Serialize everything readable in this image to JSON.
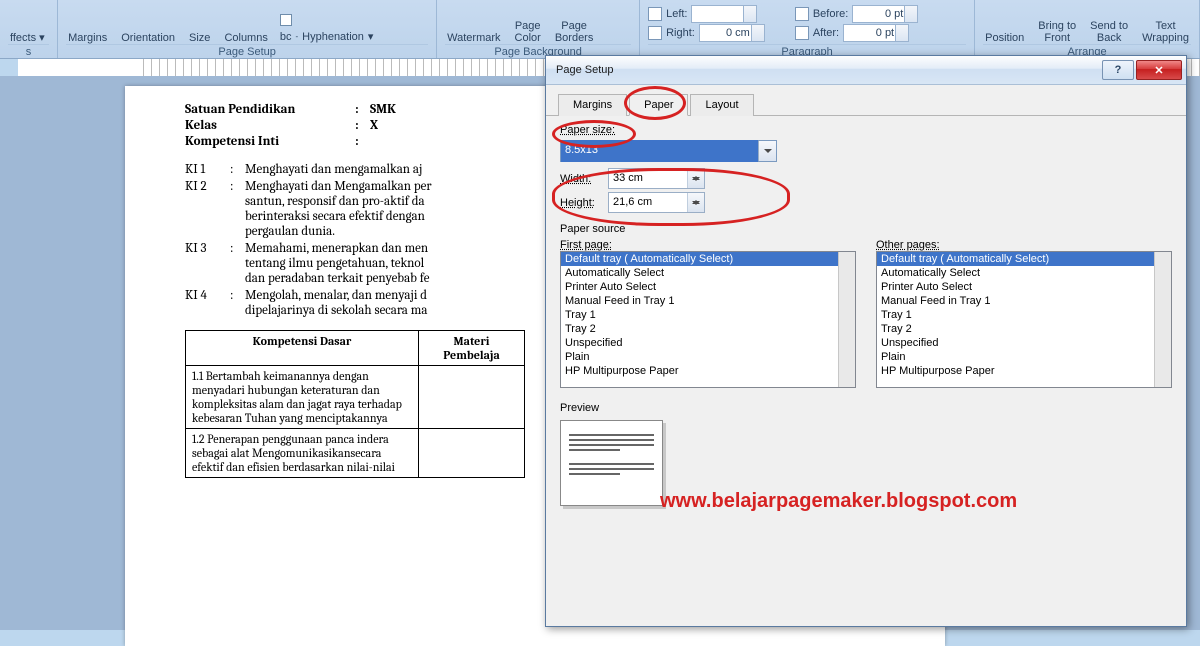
{
  "ribbon": {
    "pageSetup": {
      "label": "Page Setup",
      "margins": "Margins",
      "orientation": "Orientation",
      "size": "Size",
      "columns": "Columns",
      "hyphenation": "Hyphenation"
    },
    "pageBackground": {
      "label": "Page Background",
      "watermark": "Watermark",
      "pageColor": "Page\nColor",
      "pageBorders": "Page\nBorders"
    },
    "paragraph": {
      "label": "Paragraph",
      "left": "Left:",
      "right": "Right:",
      "before": "Before:",
      "after": "After:",
      "val_right": "0 cm",
      "val_before": "0 pt",
      "val_after": "0 pt"
    },
    "arrange": {
      "label": "Arrange",
      "position": "Position",
      "bringFront": "Bring to\nFront",
      "sendBack": "Send to\nBack",
      "textWrap": "Text\nWrapping"
    }
  },
  "document": {
    "rows": [
      {
        "label": "Satuan Pendidikan",
        "value": "SMK"
      },
      {
        "label": "Kelas",
        "value": "X"
      },
      {
        "label": "Kompetensi Inti",
        "value": ""
      }
    ],
    "ki": [
      {
        "n": "KI 1",
        "t": "Menghayati dan mengamalkan  aj"
      },
      {
        "n": "KI 2",
        "t": "Menghayati dan Mengamalkan per\nsantun, responsif dan pro-aktif da\nberinteraksi secara efektif dengan\npergaulan dunia."
      },
      {
        "n": "KI 3",
        "t": "Memahami, menerapkan dan men\ntentang ilmu pengetahuan, teknol\ndan peradaban terkait penyebab fe"
      },
      {
        "n": "KI 4",
        "t": "Mengolah, menalar, dan menyaji d\ndipelajarinya di sekolah secara ma"
      }
    ],
    "table": {
      "h1": "Kompetensi Dasar",
      "h2": "Materi\nPembelaja",
      "r1": "1.1  Bertambah keimanannya dengan menyadari hubungan keteraturan dan kompleksitas alam dan jagat raya terhadap kebesaran Tuhan yang menciptakannya",
      "r2": "1.2  Penerapan penggunaan panca indera sebagai alat Mengomunikasikansecara efektif dan efisien berdasarkan nilai-nilai"
    }
  },
  "dialog": {
    "title": "Page Setup",
    "tabs": {
      "margins": "Margins",
      "paper": "Paper",
      "layout": "Layout"
    },
    "paperSizeLabel": "Paper size:",
    "paperSizeValue": "8.5x13",
    "widthLabel": "Width:",
    "widthValue": "33 cm",
    "heightLabel": "Height:",
    "heightValue": "21,6 cm",
    "paperSource": "Paper source",
    "firstPage": "First page:",
    "otherPages": "Other pages:",
    "trayOptions": [
      "Default tray ( Automatically Select)",
      "Automatically Select",
      "Printer Auto Select",
      "Manual Feed in Tray 1",
      "Tray 1",
      "Tray 2",
      "Unspecified",
      "Plain",
      "HP Multipurpose Paper"
    ],
    "preview": "Preview"
  },
  "watermark": "www.belajarpagemaker.blogspot.com"
}
